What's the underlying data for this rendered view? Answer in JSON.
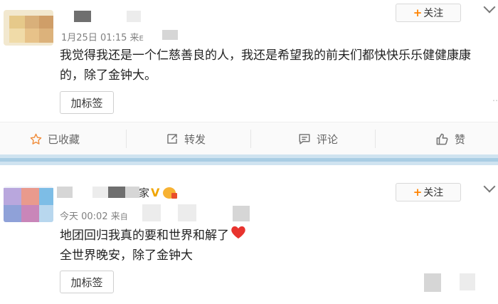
{
  "posts": [
    {
      "timestamp": "1月25日 01:15 来",
      "source_fragment": "E",
      "follow_label": "关注",
      "follow_plus": "+",
      "content_lines": [
        "我觉得我还是一个仁慈善良的人，我还是希望我的前夫们都快快乐乐健健康康",
        "的，除了金钟大。"
      ],
      "tag_label": "加标签",
      "actions": {
        "favorite": "已收藏",
        "repost": "转发",
        "comment": "评论",
        "like": "赞"
      }
    },
    {
      "name_fragment": "家",
      "timestamp": "今天 00:02 来",
      "source_fragment": "自",
      "follow_label": "关注",
      "follow_plus": "+",
      "content_lines": [
        "地团回归我真的要和世界和解了",
        "全世界晚安，除了金钟大"
      ],
      "tag_label": "加标签"
    }
  ],
  "colors": {
    "accent": "#ff8200",
    "heart": "#e8332e",
    "divider": "#cfe3f0",
    "verified": "#f0a500"
  },
  "icons": [
    "star-icon",
    "repost-icon",
    "comment-icon",
    "thumbs-up-icon",
    "heart-emoji-icon",
    "verified-v-icon",
    "chevron-down-icon"
  ]
}
